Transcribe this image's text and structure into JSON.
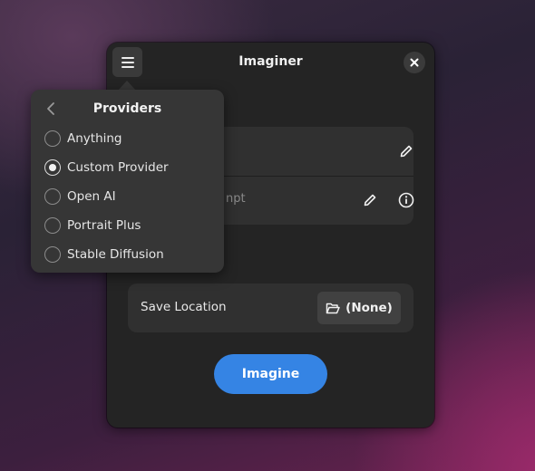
{
  "window": {
    "title": "Imaginer"
  },
  "prompts": {
    "negative_prompt_visible_text": "npt"
  },
  "save": {
    "label": "Save Location",
    "value": "(None)"
  },
  "actions": {
    "imagine_label": "Imagine"
  },
  "providers_menu": {
    "title": "Providers",
    "options": [
      {
        "label": "Anything",
        "checked": false
      },
      {
        "label": "Custom Provider",
        "checked": true
      },
      {
        "label": "Open AI",
        "checked": false
      },
      {
        "label": "Portrait Plus",
        "checked": false
      },
      {
        "label": "Stable Diffusion",
        "checked": false
      }
    ]
  },
  "colors": {
    "accent": "#3584e4",
    "window_bg": "#242424",
    "card_bg": "#303030",
    "popover_bg": "#363636"
  },
  "icons": [
    "hamburger-icon",
    "close-icon",
    "pencil-icon",
    "info-icon",
    "folder-open-icon",
    "chevron-left-icon"
  ]
}
